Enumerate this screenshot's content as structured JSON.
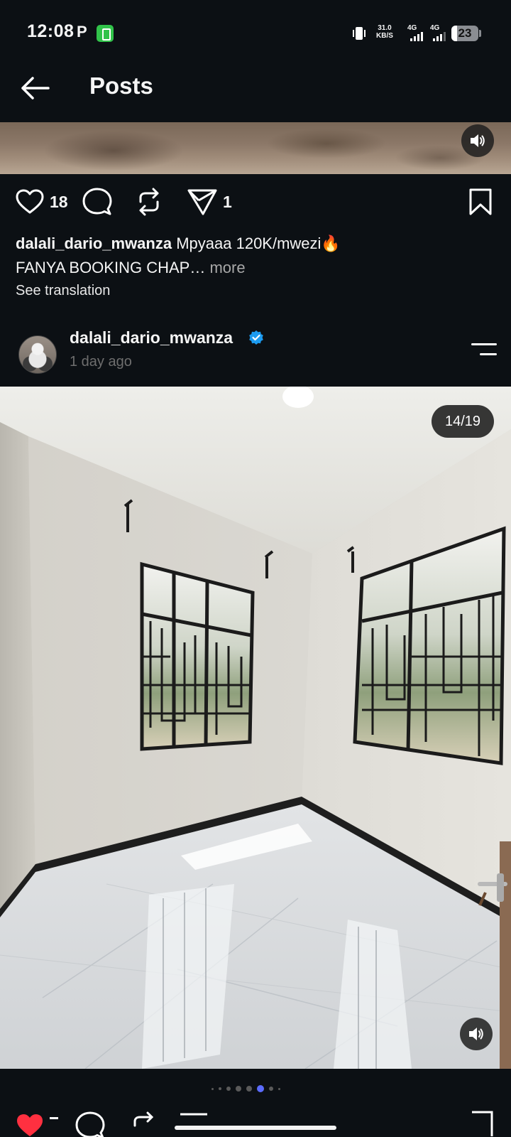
{
  "status_bar": {
    "time": "12:08",
    "carrier_icon": "P",
    "net_speed_value": "31.0",
    "net_speed_unit": "KB/S",
    "sim1": "4G",
    "sim2": "4G",
    "battery": "23"
  },
  "header": {
    "title": "Posts"
  },
  "previous_post": {
    "likes": "18",
    "shares": "1",
    "caption_user": "dalali_dario_mwanza",
    "caption_line1": "Mpyaaa 120K/mwezi🔥",
    "caption_line2": "FANYA BOOKING CHAP…",
    "more_label": "more",
    "translation_label": "See translation"
  },
  "post": {
    "username": "dalali_dario_mwanza",
    "timestamp": "1 day ago",
    "image_counter": "14/19",
    "carousel": {
      "total_dots": 8,
      "active_index": 5
    }
  },
  "icons": {
    "back": "arrow-left-icon",
    "like": "heart-icon",
    "comment": "comment-icon",
    "repost": "repost-icon",
    "share": "send-icon",
    "save": "bookmark-icon",
    "sound": "speaker-icon",
    "verified": "verified-badge-icon",
    "options": "menu-icon"
  },
  "colors": {
    "background": "#0c1014",
    "verified": "#1c9bf0",
    "active_dot": "#5b6cff",
    "muted_text": "#6e6e6e",
    "like_red": "#ff3040"
  }
}
